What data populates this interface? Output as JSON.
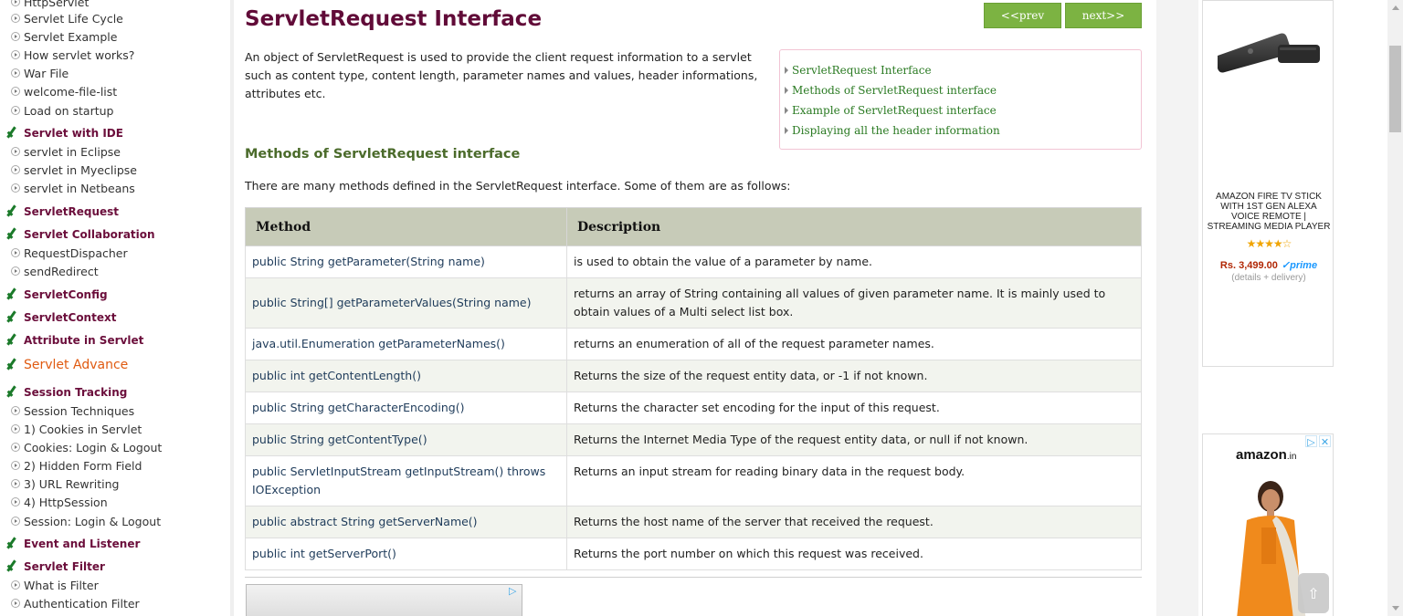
{
  "sidebar": {
    "items": [
      {
        "type": "link",
        "label": "HttpServlet"
      },
      {
        "type": "link",
        "label": "Servlet Life Cycle"
      },
      {
        "type": "link",
        "label": "Servlet Example"
      },
      {
        "type": "link",
        "label": "How servlet works?"
      },
      {
        "type": "link",
        "label": "War File"
      },
      {
        "type": "link",
        "label": "welcome-file-list"
      },
      {
        "type": "link",
        "label": "Load on startup"
      },
      {
        "type": "heading",
        "label": "Servlet with IDE"
      },
      {
        "type": "link",
        "label": "servlet in Eclipse"
      },
      {
        "type": "link",
        "label": "servlet in Myeclipse"
      },
      {
        "type": "link",
        "label": "servlet in Netbeans"
      },
      {
        "type": "heading",
        "label": "ServletRequest"
      },
      {
        "type": "heading",
        "label": "Servlet Collaboration"
      },
      {
        "type": "link",
        "label": "RequestDispacher"
      },
      {
        "type": "link",
        "label": "sendRedirect"
      },
      {
        "type": "heading",
        "label": "ServletConfig"
      },
      {
        "type": "heading",
        "label": "ServletContext"
      },
      {
        "type": "heading",
        "label": "Attribute in Servlet"
      },
      {
        "type": "heading-big",
        "label": "Servlet Advance"
      },
      {
        "type": "heading",
        "label": "Session Tracking"
      },
      {
        "type": "link",
        "label": "Session Techniques"
      },
      {
        "type": "link",
        "label": "1) Cookies in Servlet"
      },
      {
        "type": "link",
        "label": "Cookies: Login & Logout"
      },
      {
        "type": "link",
        "label": "2) Hidden Form Field"
      },
      {
        "type": "link",
        "label": "3) URL Rewriting"
      },
      {
        "type": "link",
        "label": "4) HttpSession"
      },
      {
        "type": "link",
        "label": "Session: Login & Logout"
      },
      {
        "type": "heading",
        "label": "Event and Listener"
      },
      {
        "type": "heading",
        "label": "Servlet Filter"
      },
      {
        "type": "link",
        "label": "What is Filter"
      },
      {
        "type": "link",
        "label": "Authentication Filter"
      }
    ]
  },
  "main": {
    "title": "ServletRequest Interface",
    "prev_label": "<<prev",
    "next_label": "next>>",
    "intro": "An object of ServletRequest is used to provide the client request information to a servlet such as content type, content length, parameter names and values, header informations, attributes etc.",
    "toc": [
      "ServletRequest Interface",
      "Methods of ServletRequest interface",
      "Example of ServletRequest interface",
      "Displaying all the header information"
    ],
    "section_heading": "Methods of ServletRequest interface",
    "section_text": "There are many methods defined in the ServletRequest interface. Some of them are as follows:",
    "table": {
      "headers": [
        "Method",
        "Description"
      ],
      "rows": [
        [
          "public String getParameter(String name)",
          "is used to obtain the value of a parameter by name."
        ],
        [
          "public String[] getParameterValues(String name)",
          "returns an array of String containing all values of given parameter name. It is mainly used to obtain values of a Multi select list box."
        ],
        [
          "java.util.Enumeration getParameterNames()",
          "returns an enumeration of all of the request parameter names."
        ],
        [
          "public int getContentLength()",
          "Returns the size of the request entity data, or -1 if not known."
        ],
        [
          "public String getCharacterEncoding()",
          "Returns the character set encoding for the input of this request."
        ],
        [
          "public String getContentType()",
          "Returns the Internet Media Type of the request entity data, or null if not known."
        ],
        [
          "public ServletInputStream getInputStream() throws IOException",
          "Returns an input stream for reading binary data in the request body."
        ],
        [
          "public abstract String getServerName()",
          "Returns the host name of the server that received the request."
        ],
        [
          "public int getServerPort()",
          "Returns the port number on which this request was received."
        ]
      ]
    }
  },
  "ads": {
    "product_title": "AMAZON FIRE TV STICK WITH 1ST GEN ALEXA VOICE REMOTE | STREAMING MEDIA PLAYER",
    "stars": "★★★★☆",
    "price": "Rs. 3,499.00",
    "prime": "✓prime",
    "price_note": "(details + delivery)",
    "amazon_logo": "amazon",
    "amazon_logo_suffix": ".in"
  },
  "scroll_top_icon": "⇧",
  "colors": {
    "accent_green": "#7cb342",
    "title_maroon": "#610b38",
    "heading_green": "#4b6b2b",
    "table_header": "#c7cbb8"
  }
}
